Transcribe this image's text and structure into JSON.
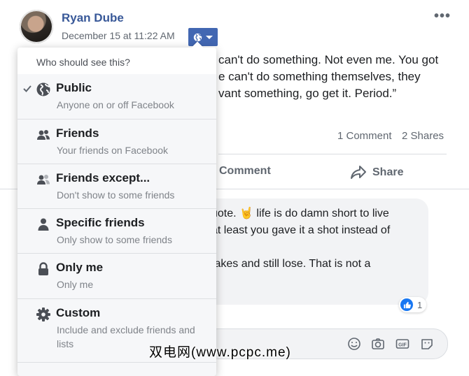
{
  "post": {
    "author": "Ryan Dube",
    "timestamp": "December 15 at 11:22 AM",
    "more_label": "•••",
    "text_lines": [
      "can't do something. Not even me. You got",
      "e can't do something themselves, they",
      "vant something, go get it. Period.”"
    ],
    "comments_count": "1 Comment",
    "shares_count": "2 Shares",
    "comment_action": "Comment",
    "share_action": "Share"
  },
  "comment": {
    "lines": [
      "uote. 🤘 life is do damn short to live",
      "at least you gave it a shot instead of",
      "",
      "takes and still lose. That is not a"
    ],
    "reaction_count": "1"
  },
  "privacy_menu": {
    "heading": "Who should see this?",
    "options": [
      {
        "icon": "globe-icon",
        "title": "Public",
        "subtitle": "Anyone on or off Facebook",
        "selected": true
      },
      {
        "icon": "friends-icon",
        "title": "Friends",
        "subtitle": "Your friends on Facebook",
        "selected": false
      },
      {
        "icon": "friends-except-icon",
        "title": "Friends except...",
        "subtitle": "Don't show to some friends",
        "selected": false
      },
      {
        "icon": "person-icon",
        "title": "Specific friends",
        "subtitle": "Only show to some friends",
        "selected": false
      },
      {
        "icon": "lock-icon",
        "title": "Only me",
        "subtitle": "Only me",
        "selected": false
      },
      {
        "icon": "gear-icon",
        "title": "Custom",
        "subtitle": "Include and exclude friends and lists",
        "selected": false
      }
    ]
  },
  "watermark": "双电网(www.pcpc.me)",
  "colors": {
    "brand_blue": "#4267b2",
    "link_blue": "#385898",
    "like_blue": "#1877f2"
  }
}
